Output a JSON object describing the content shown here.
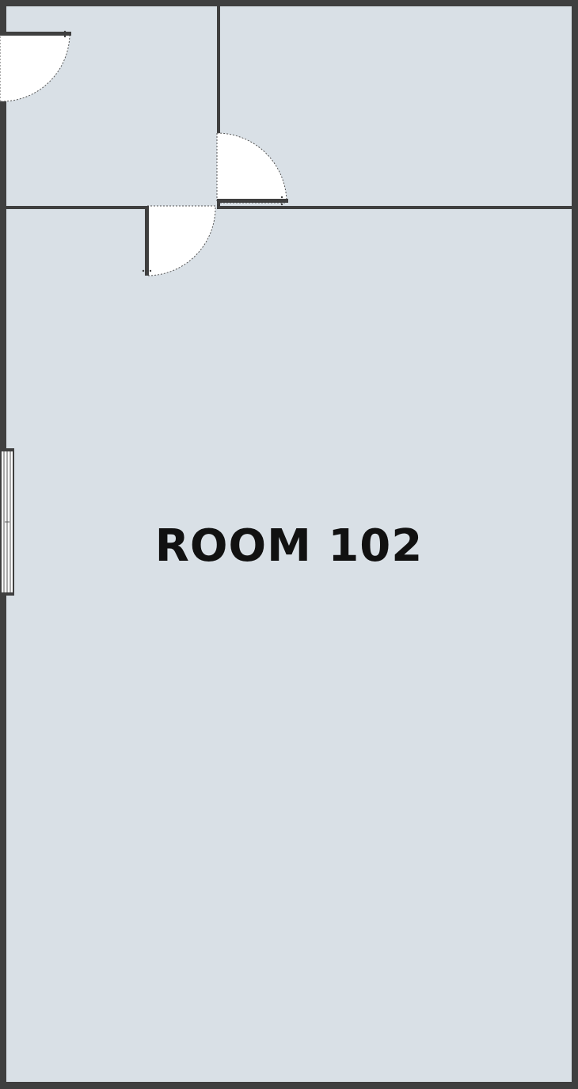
{
  "floor_plan": {
    "room_label": "ROOM 102",
    "colors": {
      "wall": "#3f3f3f",
      "floor": "#d9e0e6",
      "door_swing": "#ffffff",
      "label": "#111111"
    },
    "icons": [
      "door-icon",
      "window-icon"
    ]
  }
}
